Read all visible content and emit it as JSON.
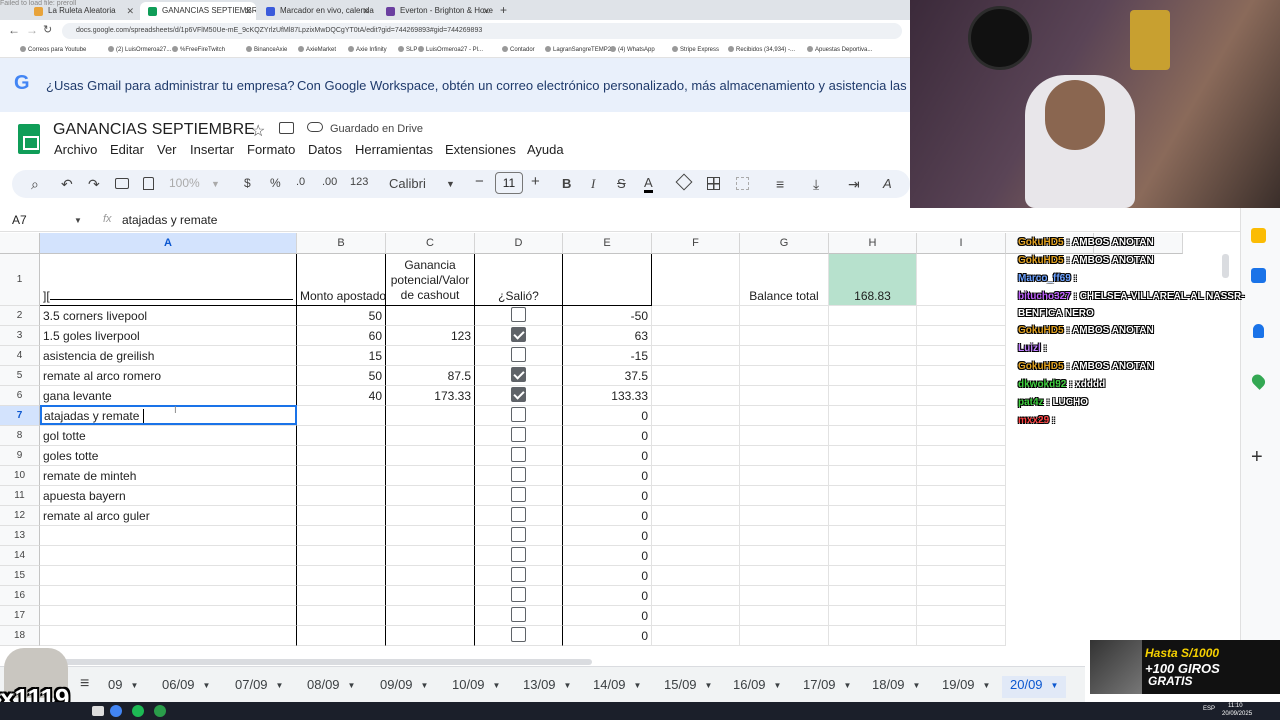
{
  "browser": {
    "tabs": [
      {
        "label": "La Ruleta Aleatoria",
        "favcolor": "#e8a33a"
      },
      {
        "label": "GANANCIAS SEPTIEMBRE - Ho...",
        "favcolor": "#0f9d58"
      },
      {
        "label": "Marcador en vivo, calendario y...",
        "favcolor": "#3b5bdb"
      },
      {
        "label": "Everton - Brighton & Hove Alb...",
        "favcolor": "#6b3fa0"
      }
    ],
    "status_text": "Failed to load file: preroll",
    "url": "docs.google.com/spreadsheets/d/1p6VFlM50Ue-mE_9cKQZYrlzUfMl87LpzixMwDQCgYT0tA/edit?gid=744269893#gid=744269893",
    "bookmarks": [
      "Correos para Youtube",
      "(2) LuisOrmeroa27...",
      "%FreeFireTwitch",
      "BinanceAxie",
      "AxieMarket",
      "Axie Infinity",
      "SLP",
      "LuisOrmeroa27 - Pl...",
      "Contador",
      "LagranSangreTEMP2",
      "(4) WhatsApp",
      "Stripe Express",
      "Recibidos (34,934) -...",
      "Apuestas Deportiva..."
    ]
  },
  "promo": {
    "logo": "G",
    "question": "¿Usas Gmail para administrar tu empresa?",
    "text": "Con Google Workspace, obtén un correo electrónico personalizado, más almacenamiento y asistencia las 24 ho"
  },
  "doc": {
    "title": "GANANCIAS SEPTIEMBRE",
    "saved": "Guardado en Drive",
    "menu": [
      "Archivo",
      "Editar",
      "Ver",
      "Insertar",
      "Formato",
      "Datos",
      "Herramientas",
      "Extensiones",
      "Ayuda"
    ]
  },
  "toolbar": {
    "zoom": "100%",
    "currency": "$",
    "percent": "%",
    "dec_less": ".0",
    "dec_more": ".00",
    "number_format": "123",
    "font": "Calibri",
    "font_size": "11",
    "bold": "B",
    "italic": "I",
    "strike": "S",
    "text_color": "A"
  },
  "formula_bar": {
    "ref": "A7",
    "fx": "fx",
    "value": "atajadas y remate"
  },
  "columns": [
    "A",
    "B",
    "C",
    "D",
    "E",
    "F",
    "G",
    "H",
    "I"
  ],
  "header_row": {
    "a": "][",
    "b": "Monto apostado",
    "c": "Ganancia potencial/Valor de cashout",
    "d": "¿Salió?",
    "g": "Balance total",
    "h": "168.83"
  },
  "rows": [
    {
      "n": "2",
      "a": "3.5 corners livepool",
      "b": "50",
      "c": "",
      "d": false,
      "e": "-50"
    },
    {
      "n": "3",
      "a": "1.5 goles liverpool",
      "b": "60",
      "c": "123",
      "d": true,
      "e": "63"
    },
    {
      "n": "4",
      "a": "asistencia de greilish",
      "b": "15",
      "c": "",
      "d": false,
      "e": "-15"
    },
    {
      "n": "5",
      "a": "remate al arco romero",
      "b": "50",
      "c": "87.5",
      "d": true,
      "e": "37.5"
    },
    {
      "n": "6",
      "a": "gana levante",
      "b": "40",
      "c": "173.33",
      "d": true,
      "e": "133.33"
    },
    {
      "n": "7",
      "a": "atajadas y remate",
      "b": "",
      "c": "",
      "d": false,
      "e": "0"
    },
    {
      "n": "8",
      "a": "gol totte",
      "b": "",
      "c": "",
      "d": false,
      "e": "0"
    },
    {
      "n": "9",
      "a": "goles totte",
      "b": "",
      "c": "",
      "d": false,
      "e": "0"
    },
    {
      "n": "10",
      "a": "remate de minteh",
      "b": "",
      "c": "",
      "d": false,
      "e": "0"
    },
    {
      "n": "11",
      "a": "apuesta bayern",
      "b": "",
      "c": "",
      "d": false,
      "e": "0"
    },
    {
      "n": "12",
      "a": "remate al arco guler",
      "b": "",
      "c": "",
      "d": false,
      "e": "0"
    },
    {
      "n": "13",
      "a": "",
      "b": "",
      "c": "",
      "d": false,
      "e": "0"
    },
    {
      "n": "14",
      "a": "",
      "b": "",
      "c": "",
      "d": false,
      "e": "0"
    },
    {
      "n": "15",
      "a": "",
      "b": "",
      "c": "",
      "d": false,
      "e": "0"
    },
    {
      "n": "16",
      "a": "",
      "b": "",
      "c": "",
      "d": false,
      "e": "0"
    },
    {
      "n": "17",
      "a": "",
      "b": "",
      "c": "",
      "d": false,
      "e": "0"
    },
    {
      "n": "18",
      "a": "",
      "b": "",
      "c": "",
      "d": false,
      "e": "0"
    }
  ],
  "sheet_tabs": [
    "09",
    "06/09",
    "07/09",
    "08/09",
    "09/09",
    "10/09",
    "13/09",
    "14/09",
    "15/09",
    "16/09",
    "17/09",
    "18/09",
    "19/09",
    "20/09"
  ],
  "active_sheet": "20/09",
  "chat": [
    {
      "user": "GokuHD5",
      "text": "AMBOS ANOTAN",
      "color": "#e0a020"
    },
    {
      "user": "GokuHD5",
      "text": "AMBOS ANOTAN",
      "color": "#e0a020"
    },
    {
      "user": "Marco_ff69",
      "text": "",
      "color": "#6aa0ff"
    },
    {
      "user": "bitucho327",
      "text": "CHELSEA-VILLAREAL-AL NASSR-BENFICA NERO",
      "color": "#c060ff"
    },
    {
      "user": "GokuHD5",
      "text": "AMBOS ANOTAN",
      "color": "#e0a020"
    },
    {
      "user": "Luizl",
      "text": "",
      "color": "#c080ff"
    },
    {
      "user": "GokuHD5",
      "text": "AMBOS ANOTAN",
      "color": "#e0a020"
    },
    {
      "user": "dkwokd92",
      "text": "xdddd",
      "color": "#40d040"
    },
    {
      "user": "pat4z",
      "text": "LUCHO",
      "color": "#40d040"
    },
    {
      "user": "mxx29",
      "text": "",
      "color": "#ff4040"
    }
  ],
  "ad": {
    "line1": "Hasta S/1000",
    "line2": "+100 GIROS",
    "line3": "GRATIS"
  },
  "overlay_count": "x1119",
  "taskbar": {
    "lang": "ESP",
    "time": "11:10",
    "date": "20/09/2025"
  },
  "colors": {
    "accent": "#1a73e8",
    "sheets_green": "#0f9d58",
    "balance_fill": "#b7e1cd"
  }
}
